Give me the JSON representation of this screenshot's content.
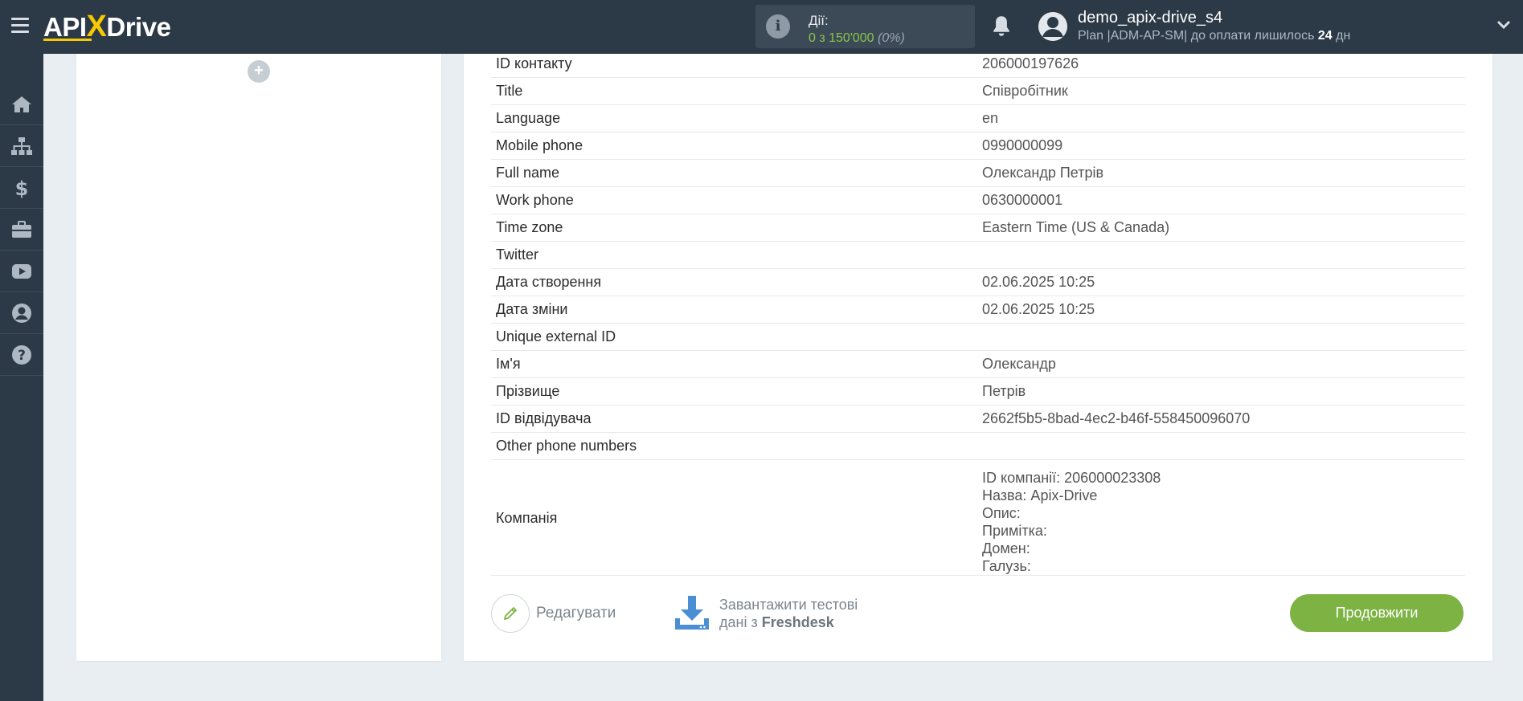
{
  "header": {
    "logo": {
      "part1": "API",
      "part2": "X",
      "part3": "Drive"
    },
    "actions": {
      "label": "Дії:",
      "count": "0 з 150'000",
      "percent": "(0%)"
    },
    "user": {
      "name": "demo_apix-drive_s4",
      "plan_prefix": "Plan |ADM-AP-SM| до оплати лишилось ",
      "days": "24",
      "days_suffix": " дн"
    }
  },
  "sidebar": {
    "items": [
      "home-icon",
      "sitemap-icon",
      "dollar-icon",
      "briefcase-icon",
      "youtube-icon",
      "user-icon",
      "help-icon"
    ]
  },
  "fields": [
    {
      "key": "ID контакту",
      "value": "206000197626"
    },
    {
      "key": "Title",
      "value": "Співробітник"
    },
    {
      "key": "Language",
      "value": "en"
    },
    {
      "key": "Mobile phone",
      "value": "0990000099"
    },
    {
      "key": "Full name",
      "value": "Олександр Петрів"
    },
    {
      "key": "Work phone",
      "value": "0630000001"
    },
    {
      "key": "Time zone",
      "value": "Eastern Time (US & Canada)"
    },
    {
      "key": "Twitter",
      "value": ""
    },
    {
      "key": "Дата створення",
      "value": "02.06.2025 10:25"
    },
    {
      "key": "Дата зміни",
      "value": "02.06.2025 10:25"
    },
    {
      "key": "Unique external ID",
      "value": ""
    },
    {
      "key": "Ім'я",
      "value": "Олександр"
    },
    {
      "key": "Прізвище",
      "value": "Петрів"
    },
    {
      "key": "ID відвідувача",
      "value": "2662f5b5-8bad-4ec2-b46f-558450096070"
    },
    {
      "key": "Other phone numbers",
      "value": ""
    }
  ],
  "company": {
    "key": "Компанія",
    "lines": [
      "ID компанії: 206000023308",
      "Назва: Apix-Drive",
      "Опис:",
      "Примітка:",
      "Домен:",
      "Галузь:"
    ]
  },
  "buttons": {
    "edit": "Редагувати",
    "load_line1": "Завантажити тестові",
    "load_line2_prefix": "дані з ",
    "load_source": "Freshdesk",
    "continue": "Продовжити"
  },
  "colors": {
    "header_bg": "#2c3a47",
    "accent_green": "#7cb342",
    "logo_yellow": "#f7c900",
    "download_blue": "#4a8fd4"
  }
}
